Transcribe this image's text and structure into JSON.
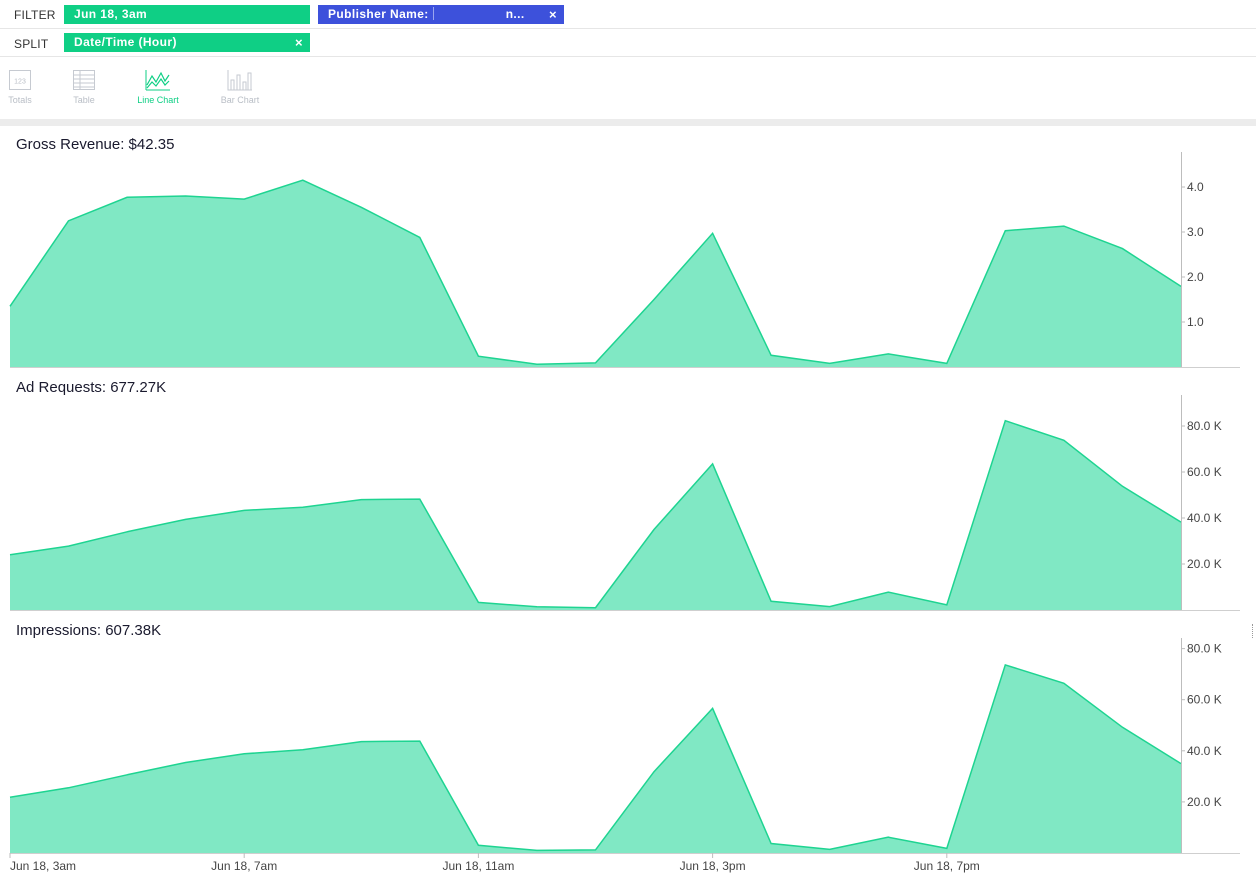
{
  "filter": {
    "label": "FILTER",
    "date_pill": "Jun 18, 3am",
    "publisher_pill_prefix": "Publisher Name:",
    "publisher_pill_suffix": "n...",
    "close_glyph": "×"
  },
  "split": {
    "label": "SPLIT",
    "pill": "Date/Time (Hour)",
    "close_glyph": "×"
  },
  "viz_types": {
    "totals_label": "Totals",
    "totals_icon_text": "123",
    "table_label": "Table",
    "line_label": "Line Chart",
    "bar_label": "Bar Chart",
    "active": "Line Chart"
  },
  "colors": {
    "accent": "#0fcf85",
    "publisher_pill": "#3d51db",
    "area_fill": "#80e8c4",
    "area_stroke": "#1ed491",
    "divider": "#ececec"
  },
  "x_tick_labels": [
    "Jun 18, 3am",
    "Jun 18, 7am",
    "Jun 18, 11am",
    "Jun 18, 3pm",
    "Jun 18, 7pm"
  ],
  "chart_data": [
    {
      "type": "area",
      "title": "Gross Revenue: $42.35",
      "x": [
        "Jun 18, 3am",
        "Jun 18, 4am",
        "Jun 18, 5am",
        "Jun 18, 6am",
        "Jun 18, 7am",
        "Jun 18, 8am",
        "Jun 18, 9am",
        "Jun 18, 10am",
        "Jun 18, 11am",
        "Jun 18, 12pm",
        "Jun 18, 1pm",
        "Jun 18, 2pm",
        "Jun 18, 3pm",
        "Jun 18, 4pm",
        "Jun 18, 5pm",
        "Jun 18, 6pm",
        "Jun 18, 7pm",
        "Jun 18, 8pm",
        "Jun 18, 9pm",
        "Jun 18, 10pm",
        "Jun 18, 11pm"
      ],
      "values": [
        1.35,
        3.25,
        3.77,
        3.8,
        3.73,
        4.15,
        3.55,
        2.88,
        0.24,
        0.06,
        0.09,
        1.5,
        2.97,
        0.26,
        0.08,
        0.29,
        0.08,
        3.03,
        3.13,
        2.63,
        1.79
      ],
      "ylim": [
        0,
        4.6
      ],
      "yticks": [
        1.0,
        2.0,
        3.0,
        4.0
      ],
      "ytick_labels": [
        "1.0",
        "2.0",
        "3.0",
        "4.0"
      ]
    },
    {
      "type": "area",
      "title": "Ad Requests: 677.27K",
      "x": [
        "Jun 18, 3am",
        "Jun 18, 4am",
        "Jun 18, 5am",
        "Jun 18, 6am",
        "Jun 18, 7am",
        "Jun 18, 8am",
        "Jun 18, 9am",
        "Jun 18, 10am",
        "Jun 18, 11am",
        "Jun 18, 12pm",
        "Jun 18, 1pm",
        "Jun 18, 2pm",
        "Jun 18, 3pm",
        "Jun 18, 4pm",
        "Jun 18, 5pm",
        "Jun 18, 6pm",
        "Jun 18, 7pm",
        "Jun 18, 8pm",
        "Jun 18, 9pm",
        "Jun 18, 10pm",
        "Jun 18, 11pm"
      ],
      "values": [
        24000,
        27800,
        34000,
        39400,
        43300,
        44700,
        48000,
        48200,
        3300,
        1400,
        1000,
        35000,
        63500,
        3800,
        1500,
        7800,
        2200,
        82300,
        73800,
        53800,
        38200
      ],
      "ylim": [
        0,
        90000
      ],
      "yticks": [
        20000,
        40000,
        60000,
        80000
      ],
      "ytick_labels": [
        "20.0 K",
        "40.0 K",
        "60.0 K",
        "80.0 K"
      ]
    },
    {
      "type": "area",
      "title": "Impressions: 607.38K",
      "x": [
        "Jun 18, 3am",
        "Jun 18, 4am",
        "Jun 18, 5am",
        "Jun 18, 6am",
        "Jun 18, 7am",
        "Jun 18, 8am",
        "Jun 18, 9am",
        "Jun 18, 10am",
        "Jun 18, 11am",
        "Jun 18, 12pm",
        "Jun 18, 1pm",
        "Jun 18, 2pm",
        "Jun 18, 3pm",
        "Jun 18, 4pm",
        "Jun 18, 5pm",
        "Jun 18, 6pm",
        "Jun 18, 7pm",
        "Jun 18, 8pm",
        "Jun 18, 9pm",
        "Jun 18, 10pm",
        "Jun 18, 11pm"
      ],
      "values": [
        21800,
        25500,
        30600,
        35400,
        38800,
        40400,
        43600,
        43800,
        3000,
        1000,
        1200,
        31800,
        56600,
        3700,
        1400,
        6200,
        1800,
        73600,
        66400,
        49200,
        35000
      ],
      "ylim": [
        0,
        81000
      ],
      "yticks": [
        20000,
        40000,
        60000,
        80000
      ],
      "ytick_labels": [
        "20.0 K",
        "40.0 K",
        "60.0 K",
        "80.0 K"
      ]
    }
  ]
}
